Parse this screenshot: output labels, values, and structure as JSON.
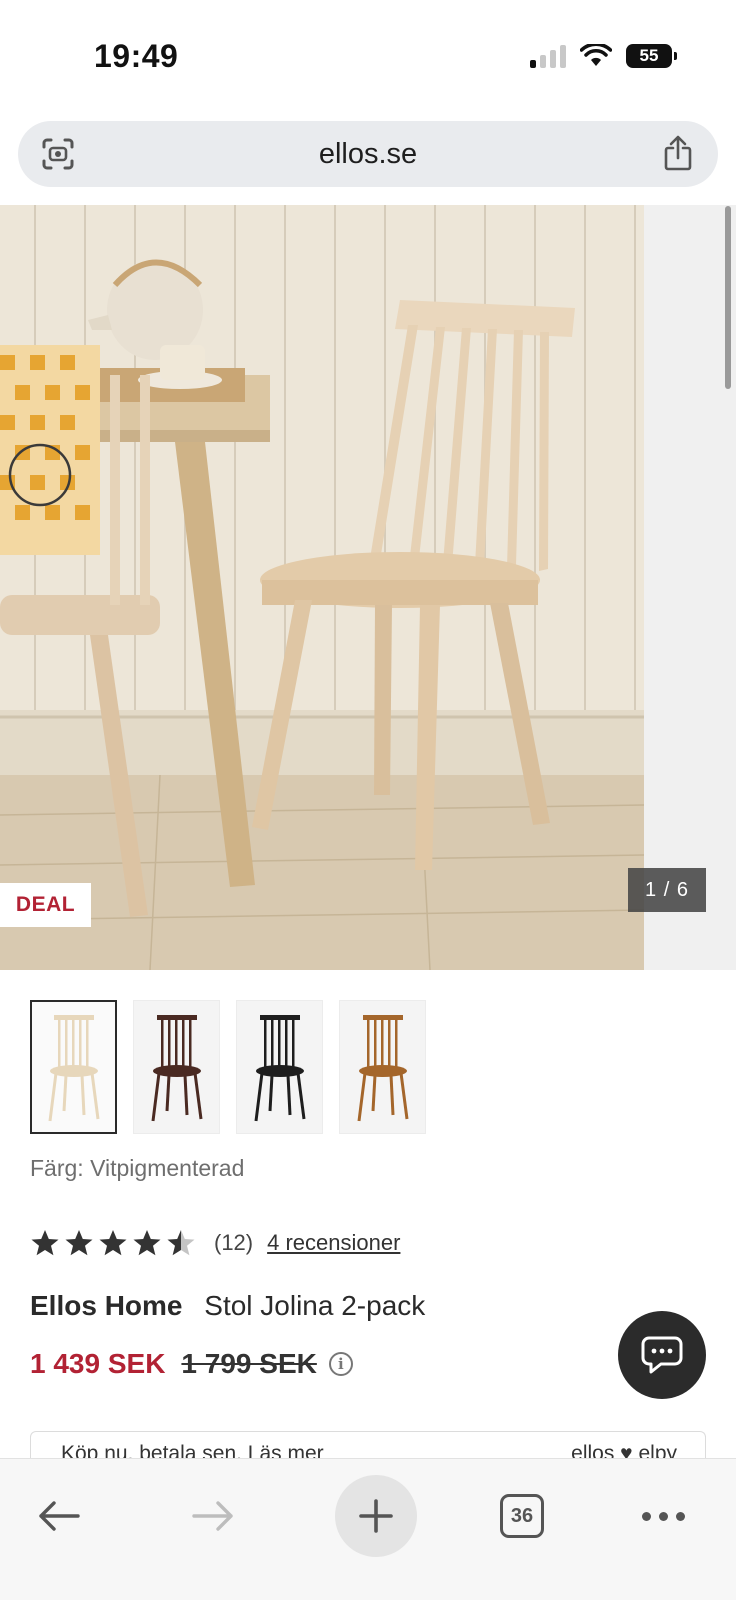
{
  "status_bar": {
    "time": "19:49",
    "battery": "55"
  },
  "browser": {
    "url": "ellos.se",
    "left_icon": "camera-scan-icon",
    "right_icon": "share-icon"
  },
  "gallery": {
    "badge": "DEAL",
    "counter": "1 / 6"
  },
  "thumbnails": [
    {
      "name": "white-pigmented",
      "color": "#e7d7bb",
      "selected": true
    },
    {
      "name": "dark-brown",
      "color": "#4a2a22",
      "selected": false
    },
    {
      "name": "black",
      "color": "#1e1e1e",
      "selected": false
    },
    {
      "name": "oak-brown",
      "color": "#a4662b",
      "selected": false
    }
  ],
  "product": {
    "color_label": "Färg:",
    "color_value": "Vitpigmenterad",
    "rating": 4.5,
    "rating_count": "(12)",
    "reviews_link": "4 recensioner",
    "brand": "Ellos Home",
    "name": "Stol Jolina 2-pack",
    "price_new": "1 439 SEK",
    "price_old": "1 799 SEK"
  },
  "bnpl": {
    "text": "Köp nu, betala sen. Läs mer",
    "logo": "ellos ♥ elpy"
  },
  "toolbar": {
    "tabs_count": "36"
  },
  "colors": {
    "price_accent": "#b22234",
    "deal_accent": "#b22234"
  }
}
